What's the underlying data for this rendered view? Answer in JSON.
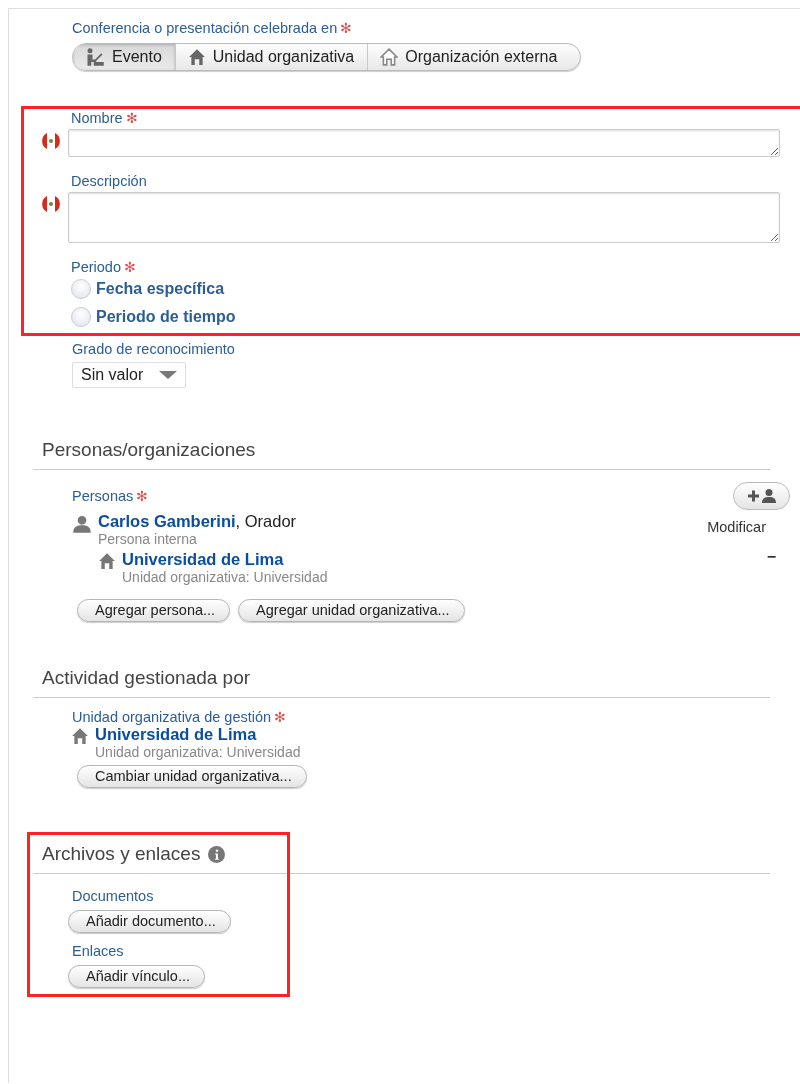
{
  "venue": {
    "label": "Conferencia o presentación celebrada en",
    "required_mark": "✻",
    "options": [
      {
        "label": "Evento",
        "selected": true,
        "kind": "event"
      },
      {
        "label": "Unidad organizativa",
        "selected": false,
        "kind": "unit"
      },
      {
        "label": "Organización externa",
        "selected": false,
        "kind": "external"
      }
    ]
  },
  "name_field": {
    "label": "Nombre",
    "required_mark": "✻"
  },
  "description_field": {
    "label": "Descripción"
  },
  "period": {
    "label": "Periodo",
    "required_mark": "✻",
    "options": [
      {
        "label": "Fecha específica",
        "selected": false
      },
      {
        "label": "Periodo de tiempo",
        "selected": false
      }
    ]
  },
  "recognition": {
    "label": "Grado de reconocimiento",
    "value": "Sin valor"
  },
  "persons_section": {
    "title": "Personas/organizaciones",
    "label": "Personas",
    "required_mark": "✻",
    "entries": [
      {
        "name": "Carlos Gamberini",
        "role": ", Orador",
        "subtitle": "Persona interna",
        "action": "Modificar",
        "affiliations": [
          {
            "name": "Universidad de Lima",
            "subtitle": "Unidad organizativa: Universidad",
            "action": "−"
          }
        ]
      }
    ],
    "buttons": [
      "Agregar persona...",
      "Agregar unidad organizativa..."
    ]
  },
  "managed_section": {
    "title": "Actividad gestionada por",
    "label": "Unidad organizativa de gestión",
    "required_mark": "✻",
    "unit": {
      "name": "Universidad de Lima",
      "subtitle": "Unidad organizativa: Universidad"
    },
    "button": "Cambiar unidad organizativa..."
  },
  "files_section": {
    "title": "Archivos y enlaces",
    "groups": [
      {
        "label": "Documentos",
        "button": "Añadir documento..."
      },
      {
        "label": "Enlaces",
        "button": "Añadir vínculo..."
      }
    ]
  }
}
